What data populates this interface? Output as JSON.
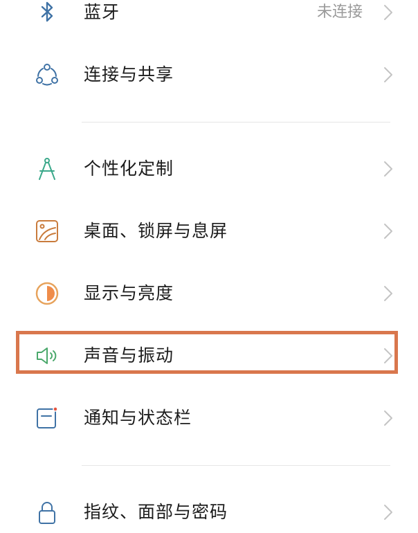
{
  "settings": {
    "items": [
      {
        "id": "bluetooth",
        "label": "蓝牙",
        "status": "未连接",
        "icon": "bluetooth-icon"
      },
      {
        "id": "connection-sharing",
        "label": "连接与共享",
        "icon": "connection-sharing-icon"
      },
      {
        "id": "personalization",
        "label": "个性化定制",
        "icon": "compass-icon"
      },
      {
        "id": "wallpaper-lockscreen",
        "label": "桌面、锁屏与息屏",
        "icon": "wallpaper-icon"
      },
      {
        "id": "display-brightness",
        "label": "显示与亮度",
        "icon": "brightness-icon"
      },
      {
        "id": "sound-vibration",
        "label": "声音与振动",
        "icon": "speaker-icon"
      },
      {
        "id": "notification-statusbar",
        "label": "通知与状态栏",
        "icon": "notification-icon"
      },
      {
        "id": "fingerprint-face-password",
        "label": "指纹、面部与密码",
        "icon": "lock-icon"
      }
    ]
  },
  "colors": {
    "highlight_border": "#d9774d",
    "status_text": "#9a9a9a",
    "chevron": "#c4c4c4",
    "divider": "#e6e6e6"
  }
}
